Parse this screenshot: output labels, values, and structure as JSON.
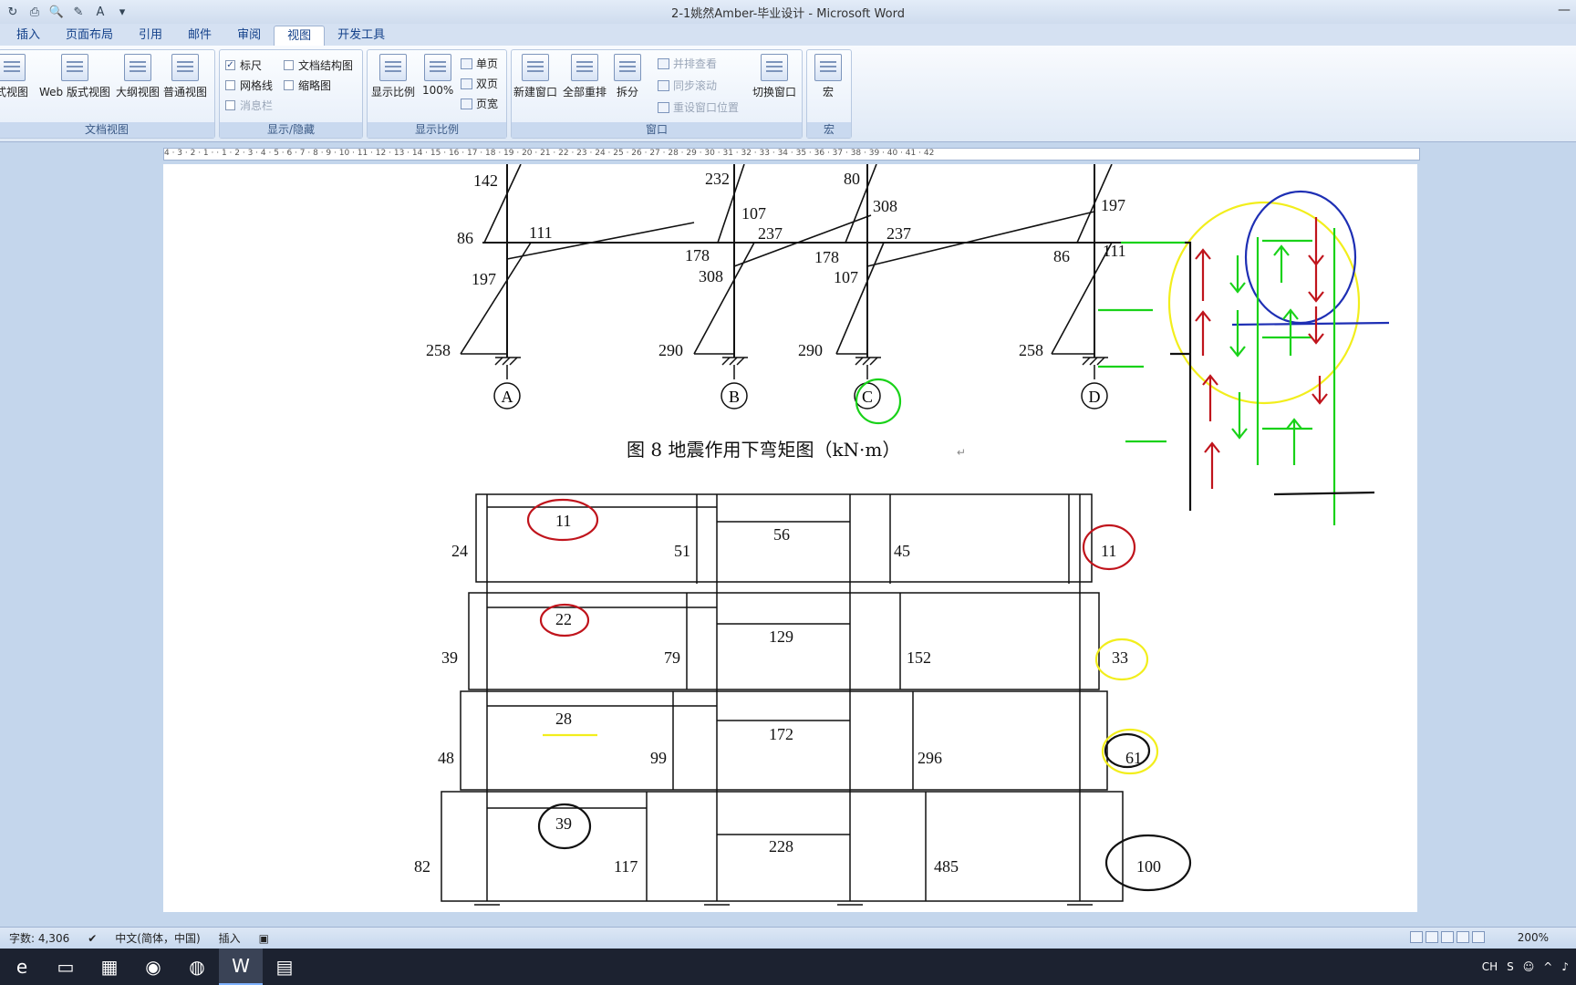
{
  "window": {
    "title": "2-1姚然Amber-毕业设计 - Microsoft Word"
  },
  "ribbon": {
    "tabs": [
      {
        "label": "插入",
        "active": false
      },
      {
        "label": "页面布局",
        "active": false
      },
      {
        "label": "引用",
        "active": false
      },
      {
        "label": "邮件",
        "active": false
      },
      {
        "label": "审阅",
        "active": false
      },
      {
        "label": "视图",
        "active": true
      },
      {
        "label": "开发工具",
        "active": false
      }
    ],
    "group_doc_views": {
      "label": "文档视图",
      "buttons": [
        "式视图",
        "Web 版式视图",
        "大纲视图",
        "普通视图"
      ]
    },
    "group_show_hide": {
      "label": "显示/隐藏",
      "ruler": "标尺",
      "gridlines": "网格线",
      "message_bar": "消息栏",
      "doc_map": "文档结构图",
      "thumbnails": "缩略图"
    },
    "group_zoom": {
      "label": "显示比例",
      "zoom": "显示比例",
      "hundred": "100%",
      "one_page": "单页",
      "two_pages": "双页",
      "page_width": "页宽"
    },
    "group_window": {
      "label": "窗口",
      "new_window": "新建窗口",
      "arrange_all": "全部重排",
      "split": "拆分",
      "side_by_side": "并排查看",
      "sync_scroll": "同步滚动",
      "reset_position": "重设窗口位置",
      "switch_windows": "切换窗口"
    },
    "group_macros": {
      "label": "宏",
      "macros": "宏"
    }
  },
  "ruler": {
    "numbers": "4 · 3 · 2 · 1 · · 1 · 2 · 3 · 4 · 5 · 6 · 7 · 8 · 9 · 10 · 11 · 12 · 13 · 14 · 15 · 16 · 17 · 18 · 19 · 20 · 21 · 22 · 23 · 24 · 25 · 26 · 27 · 28 · 29 · 30 · 31 · 32 · 33 · 34 · 35 · 36 · 37 · 38 · 39 · 40 · 41 · 42"
  },
  "document": {
    "figure_caption": "图 8   地震作用下弯矩图（kN·m）",
    "moment_labels": {
      "a_top": "142",
      "a_mid_left": "86",
      "a_mid_right": "111",
      "a_lower": "197",
      "a_base": "258",
      "b_top": "232",
      "b_beam": "107",
      "b_right": "237",
      "b_left": "178",
      "b_lower": "308",
      "b_base": "290",
      "c_top": "80",
      "c_beam": "308",
      "c_right": "237",
      "c_left": "178",
      "c_lower": "107",
      "c_base": "290",
      "d_beam": "197",
      "d_left": "86",
      "d_right": "111",
      "d_base": "258"
    },
    "axis_labels": [
      "A",
      "B",
      "C",
      "D"
    ],
    "shear_labels": {
      "r1": [
        "24",
        "11",
        "51",
        "56",
        "45",
        "11"
      ],
      "r2": [
        "39",
        "22",
        "79",
        "129",
        "152",
        "33"
      ],
      "r3": [
        "48",
        "28",
        "99",
        "172",
        "296",
        "61"
      ],
      "r4": [
        "82",
        "39",
        "117",
        "228",
        "485",
        "100"
      ]
    }
  },
  "statusbar": {
    "word_count": "字数: 4,306",
    "language": "中文(简体，中国)",
    "mode": "插入",
    "zoom": "200%"
  },
  "taskbar": {
    "tray_lang": "CH"
  },
  "colors": {
    "ink_red": "#c0141c",
    "ink_blue": "#1e2fb4",
    "ink_green": "#19d219",
    "ink_yellow": "#f2ee1c",
    "ink_black": "#111111"
  }
}
